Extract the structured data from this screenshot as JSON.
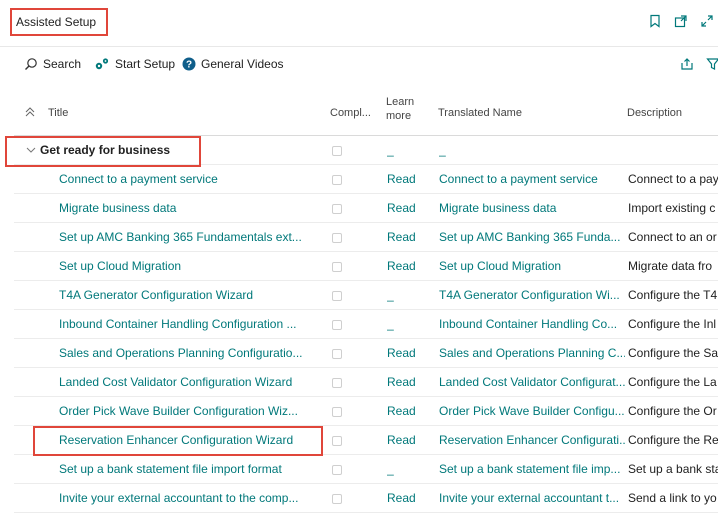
{
  "page": {
    "title": "Assisted Setup"
  },
  "toolbar": {
    "search_label": "Search",
    "start_setup_label": "Start Setup",
    "general_videos_label": "General Videos"
  },
  "grid": {
    "columns": {
      "title": "Title",
      "completed": "Compl...",
      "learn_more": "Learn more",
      "translated_name": "Translated Name",
      "description": "Description"
    },
    "group": {
      "title": "Get ready for business",
      "learn_more": "_",
      "translated_name": "_"
    },
    "rows": [
      {
        "title": "Connect to a payment service",
        "learn": "Read",
        "translated": "Connect to a payment service",
        "desc": "Connect to a pay"
      },
      {
        "title": "Migrate business data",
        "learn": "Read",
        "translated": "Migrate business data",
        "desc": "Import existing c"
      },
      {
        "title": "Set up AMC Banking 365 Fundamentals ext...",
        "learn": "Read",
        "translated": "Set up AMC Banking 365 Funda...",
        "desc": "Connect to an or"
      },
      {
        "title": "Set up Cloud Migration",
        "learn": "Read",
        "translated": "Set up Cloud Migration",
        "desc": "Migrate data fro"
      },
      {
        "title": "T4A Generator Configuration Wizard",
        "learn": "_",
        "translated": "T4A Generator Configuration Wi...",
        "desc": "Configure the T4"
      },
      {
        "title": "Inbound Container Handling Configuration ...",
        "learn": "_",
        "translated": "Inbound Container Handling Co...",
        "desc": "Configure the Inl"
      },
      {
        "title": "Sales and Operations Planning Configuratio...",
        "learn": "Read",
        "translated": "Sales and Operations Planning C...",
        "desc": "Configure the Sa"
      },
      {
        "title": "Landed Cost Validator Configuration Wizard",
        "learn": "Read",
        "translated": "Landed Cost Validator Configurat...",
        "desc": "Configure the La"
      },
      {
        "title": "Order Pick Wave Builder Configuration Wiz...",
        "learn": "Read",
        "translated": "Order Pick Wave Builder Configu...",
        "desc": "Configure the Or"
      },
      {
        "title": "Reservation Enhancer Configuration Wizard",
        "learn": "Read",
        "translated": "Reservation Enhancer Configurati...",
        "desc": "Configure the Re"
      },
      {
        "title": "Set up a bank statement file import format",
        "learn": "_",
        "translated": "Set up a bank statement file imp...",
        "desc": "Set up a bank sta"
      },
      {
        "title": "Invite your external accountant to the comp...",
        "learn": "Read",
        "translated": "Invite your external accountant t...",
        "desc": "Send a link to yo"
      }
    ]
  },
  "colors": {
    "accent": "#00787a",
    "highlight": "#e0463a"
  }
}
